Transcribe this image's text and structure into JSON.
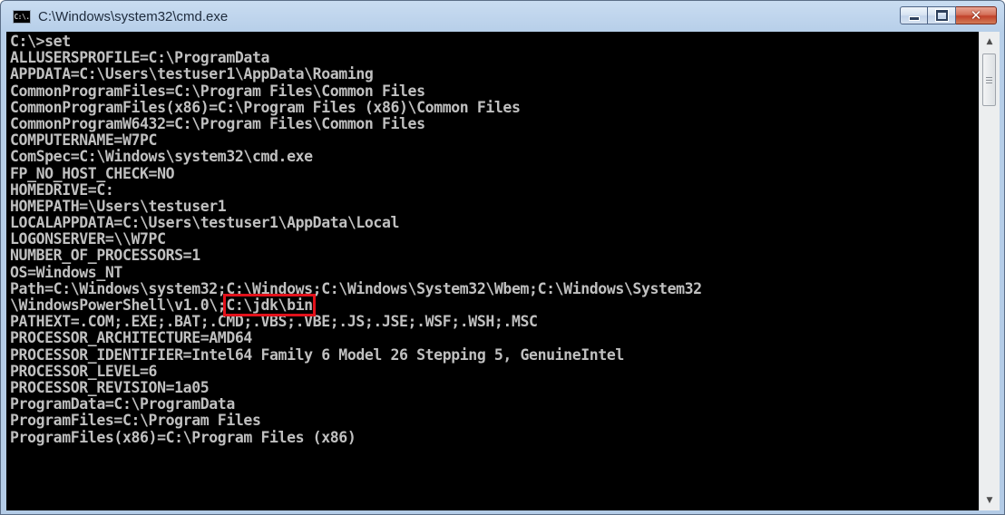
{
  "window": {
    "title": "C:\\Windows\\system32\\cmd.exe",
    "icon_text": "C:\\."
  },
  "controls": {
    "minimize": "minimize-icon",
    "maximize": "maximize-icon",
    "close_glyph": "✕"
  },
  "console": {
    "lines": [
      "C:\\>set",
      "ALLUSERSPROFILE=C:\\ProgramData",
      "APPDATA=C:\\Users\\testuser1\\AppData\\Roaming",
      "CommonProgramFiles=C:\\Program Files\\Common Files",
      "CommonProgramFiles(x86)=C:\\Program Files (x86)\\Common Files",
      "CommonProgramW6432=C:\\Program Files\\Common Files",
      "COMPUTERNAME=W7PC",
      "ComSpec=C:\\Windows\\system32\\cmd.exe",
      "FP_NO_HOST_CHECK=NO",
      "HOMEDRIVE=C:",
      "HOMEPATH=\\Users\\testuser1",
      "LOCALAPPDATA=C:\\Users\\testuser1\\AppData\\Local",
      "LOGONSERVER=\\\\W7PC",
      "NUMBER_OF_PROCESSORS=1",
      "OS=Windows_NT",
      "Path=C:\\Windows\\system32;C:\\Windows;C:\\Windows\\System32\\Wbem;C:\\Windows\\System32",
      "\\WindowsPowerShell\\v1.0\\;",
      "PATHEXT=.COM;.EXE;.BAT;.CMD;.VBS;.VBE;.JS;.JSE;.WSF;.WSH;.MSC",
      "PROCESSOR_ARCHITECTURE=AMD64",
      "PROCESSOR_IDENTIFIER=Intel64 Family 6 Model 26 Stepping 5, GenuineIntel",
      "PROCESSOR_LEVEL=6",
      "PROCESSOR_REVISION=1a05",
      "ProgramData=C:\\ProgramData",
      "ProgramFiles=C:\\Program Files",
      "ProgramFiles(x86)=C:\\Program Files (x86)"
    ],
    "highlighted_path": "C:\\jdk\\bin",
    "highlight_color": "#e2121b",
    "text_color": "#c0c0c0",
    "background_color": "#000000"
  },
  "scrollbar": {
    "up_arrow": "▲",
    "down_arrow": "▼"
  }
}
